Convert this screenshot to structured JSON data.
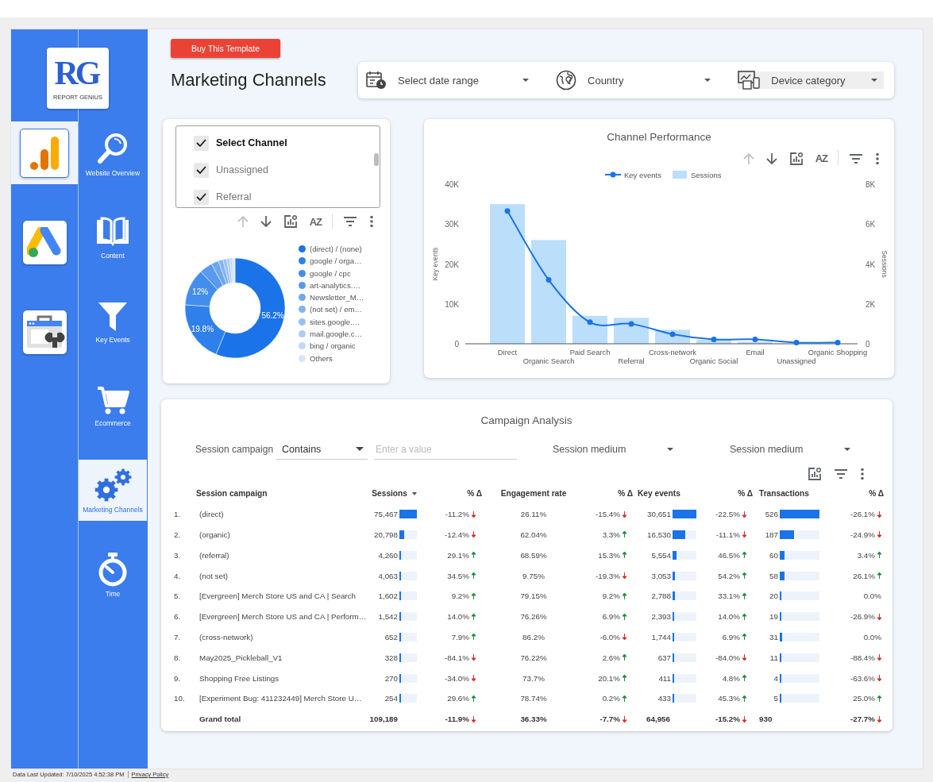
{
  "sidebar": {
    "logo": {
      "mark": "RG",
      "name": "REPORT GENIUS"
    },
    "apps": [
      {
        "kind": "analytics",
        "selected": true
      },
      {
        "kind": "ads",
        "selected": false
      },
      {
        "kind": "search-console",
        "selected": false
      }
    ],
    "nav": [
      {
        "kind": "search",
        "label": "Website Overview",
        "selected": false
      },
      {
        "kind": "book",
        "label": "Content",
        "selected": false
      },
      {
        "kind": "funnel",
        "label": "Key Events",
        "selected": false
      },
      {
        "kind": "cart",
        "label": "Ecommerce",
        "selected": false
      },
      {
        "kind": "gears",
        "label": "Marketing Channels",
        "selected": true
      },
      {
        "kind": "stopwatch",
        "label": "Time",
        "selected": false
      }
    ]
  },
  "header": {
    "button": "Buy This Template",
    "title": "Marketing Channels"
  },
  "filters": [
    {
      "kind": "date",
      "label": "Select date range",
      "highlighted": false
    },
    {
      "kind": "country",
      "label": "Country",
      "highlighted": false
    },
    {
      "kind": "device",
      "label": "Device category",
      "highlighted": true
    }
  ],
  "channel_card": {
    "checklist": [
      {
        "kind": "header",
        "label": "Select Channel",
        "checked": true
      },
      {
        "kind": "option",
        "label": "Unassigned",
        "checked": true
      },
      {
        "kind": "option",
        "label": "Referral",
        "checked": true
      }
    ],
    "toolbar": [
      {
        "kind": "up",
        "disabled": true
      },
      {
        "kind": "down",
        "disabled": false
      },
      {
        "kind": "chart-settings",
        "disabled": false
      },
      {
        "kind": "sort",
        "text": "AZ",
        "disabled": false
      },
      {
        "kind": "filter",
        "disabled": false
      },
      {
        "kind": "more",
        "disabled": false
      }
    ],
    "chart_data": {
      "type": "donut",
      "categories": [
        "(direct) / (none)",
        "google / orga…",
        "google / cpc",
        "art-analytics.…",
        "Newsletter_M…",
        "(not set) / em…",
        "sites.google.…",
        "mail.google.c…",
        "bing / organic",
        "Others"
      ],
      "values": [
        56.2,
        19.8,
        12,
        4.2,
        2.4,
        1.5,
        1.2,
        1.0,
        0.9,
        0.8
      ],
      "value_labels": [
        "56.2%",
        "19.8%",
        "12%",
        null,
        null,
        null,
        null,
        null,
        null,
        null
      ]
    }
  },
  "performance": {
    "toolbar": [
      {
        "kind": "up",
        "disabled": true
      },
      {
        "kind": "down",
        "disabled": false
      },
      {
        "kind": "chart-settings",
        "disabled": false
      },
      {
        "kind": "sort",
        "text": "AZ",
        "disabled": false
      },
      {
        "kind": "filter",
        "disabled": false
      },
      {
        "kind": "more",
        "disabled": false
      }
    ],
    "chart_data": {
      "type": "bar",
      "title": "Channel Performance",
      "ylabel": "Key events",
      "y2label": "Sessions",
      "legend": "top",
      "categories": [
        "Direct",
        "Organic Search",
        "Paid Search",
        "Referral",
        "Cross-network",
        "Organic Social",
        "Email",
        "Unassigned",
        "Organic Shopping"
      ],
      "series": [
        {
          "name": "Key events",
          "type": "line",
          "axis": "y",
          "marker": "circle",
          "color": "#1a73e8",
          "values": [
            33300,
            16000,
            5400,
            5000,
            2400,
            1100,
            1100,
            300,
            300
          ]
        },
        {
          "name": "Sessions",
          "type": "bar",
          "axis": "y2",
          "color": "#bbdefb",
          "values": [
            7000,
            5200,
            1400,
            1300,
            700,
            200,
            100,
            null,
            null
          ]
        }
      ],
      "ylim": [
        0,
        40000
      ],
      "y2lim": [
        0,
        8000
      ],
      "yticks": [
        {
          "value": 0,
          "label": "0"
        },
        {
          "value": 10000,
          "label": "10K"
        },
        {
          "value": 20000,
          "label": "20K"
        },
        {
          "value": 30000,
          "label": "30K"
        },
        {
          "value": 40000,
          "label": "40K"
        }
      ],
      "y2ticks": [
        {
          "value": 0,
          "label": "0"
        },
        {
          "value": 2000,
          "label": "2K"
        },
        {
          "value": 4000,
          "label": "4K"
        },
        {
          "value": 6000,
          "label": "6K"
        },
        {
          "value": 8000,
          "label": "8K"
        }
      ]
    }
  },
  "campaign": {
    "title": "Campaign Analysis",
    "filter": {
      "label": "Session campaign",
      "operator": "Contains",
      "placeholder": "Enter a value",
      "dropdowns": [
        "Session medium",
        "Session medium"
      ]
    },
    "toolbar": [
      {
        "kind": "chart-settings",
        "disabled": false
      },
      {
        "kind": "filter",
        "disabled": false
      },
      {
        "kind": "more",
        "disabled": false
      }
    ],
    "columns": [
      {
        "label": "Session campaign",
        "sorted": false
      },
      {
        "label": "Sessions",
        "sorted": true
      },
      {
        "label": "% Δ",
        "sorted": false
      },
      {
        "label": "Engagement rate",
        "sorted": false
      },
      {
        "label": "% Δ",
        "sorted": false
      },
      {
        "label": "Key events",
        "sorted": false
      },
      {
        "label": "% Δ",
        "sorted": false
      },
      {
        "label": "Transactions",
        "sorted": false
      },
      {
        "label": "% Δ",
        "sorted": false
      }
    ],
    "rows": [
      {
        "kind": "data",
        "rank": "1.",
        "cells": [
          {
            "kind": "name",
            "text": "(direct)"
          },
          {
            "kind": "bar",
            "text": "75,467",
            "level": 1
          },
          {
            "kind": "down",
            "text": "-11.2%"
          },
          {
            "kind": "plain",
            "text": "26.11%"
          },
          {
            "kind": "down",
            "text": "-15.4%"
          },
          {
            "kind": "bar",
            "text": "30,651",
            "level": 1
          },
          {
            "kind": "down",
            "text": "-22.5%"
          },
          {
            "kind": "bar",
            "text": "526",
            "level": 1
          },
          {
            "kind": "down",
            "text": "-26.1%"
          }
        ]
      },
      {
        "kind": "data",
        "rank": "2.",
        "cells": [
          {
            "kind": "name",
            "text": "(organic)"
          },
          {
            "kind": "bar",
            "text": "20,798",
            "level": 0.276
          },
          {
            "kind": "down",
            "text": "-12.4%"
          },
          {
            "kind": "plain",
            "text": "62.04%"
          },
          {
            "kind": "up",
            "text": "3.3%"
          },
          {
            "kind": "bar",
            "text": "16,530",
            "level": 0.539
          },
          {
            "kind": "down",
            "text": "-11.1%"
          },
          {
            "kind": "bar",
            "text": "187",
            "level": 0.356
          },
          {
            "kind": "down",
            "text": "-24.9%"
          }
        ]
      },
      {
        "kind": "data",
        "rank": "3.",
        "cells": [
          {
            "kind": "name",
            "text": "(referral)"
          },
          {
            "kind": "bar",
            "text": "4,260",
            "level": 0.056
          },
          {
            "kind": "up",
            "text": "29.1%"
          },
          {
            "kind": "plain",
            "text": "68.59%"
          },
          {
            "kind": "up",
            "text": "15.3%"
          },
          {
            "kind": "bar",
            "text": "5,554",
            "level": 0.181
          },
          {
            "kind": "up",
            "text": "46.5%"
          },
          {
            "kind": "bar",
            "text": "60",
            "level": 0.114
          },
          {
            "kind": "up",
            "text": "3.4%"
          }
        ]
      },
      {
        "kind": "data",
        "rank": "4.",
        "cells": [
          {
            "kind": "name",
            "text": "(not set)"
          },
          {
            "kind": "bar",
            "text": "4,063",
            "level": 0.054
          },
          {
            "kind": "up",
            "text": "34.5%"
          },
          {
            "kind": "plain",
            "text": "9.75%"
          },
          {
            "kind": "down",
            "text": "-19.3%"
          },
          {
            "kind": "bar",
            "text": "3,053",
            "level": 0.1
          },
          {
            "kind": "up",
            "text": "54.2%"
          },
          {
            "kind": "bar",
            "text": "58",
            "level": 0.11
          },
          {
            "kind": "up",
            "text": "26.1%"
          }
        ]
      },
      {
        "kind": "data",
        "rank": "5.",
        "cells": [
          {
            "kind": "name",
            "text": "[Evergreen] Merch Store US and CA | Search"
          },
          {
            "kind": "bar",
            "text": "1,602",
            "level": 0.021
          },
          {
            "kind": "up",
            "text": "9.2%"
          },
          {
            "kind": "plain",
            "text": "79.15%"
          },
          {
            "kind": "up",
            "text": "9.2%"
          },
          {
            "kind": "bar",
            "text": "2,788",
            "level": 0.091
          },
          {
            "kind": "up",
            "text": "33.1%"
          },
          {
            "kind": "bar",
            "text": "20",
            "level": 0.038
          },
          {
            "kind": "flat",
            "text": "0.0%"
          }
        ]
      },
      {
        "kind": "data",
        "rank": "6.",
        "cells": [
          {
            "kind": "name",
            "text": "[Evergreen] Merch Store US and CA | Perform…"
          },
          {
            "kind": "bar",
            "text": "1,542",
            "level": 0.02
          },
          {
            "kind": "up",
            "text": "14.0%"
          },
          {
            "kind": "plain",
            "text": "76.26%"
          },
          {
            "kind": "up",
            "text": "6.9%"
          },
          {
            "kind": "bar",
            "text": "2,393",
            "level": 0.078
          },
          {
            "kind": "up",
            "text": "14.0%"
          },
          {
            "kind": "bar",
            "text": "19",
            "level": 0.036
          },
          {
            "kind": "down",
            "text": "-26.9%"
          }
        ]
      },
      {
        "kind": "data",
        "rank": "7.",
        "cells": [
          {
            "kind": "name",
            "text": "(cross-network)"
          },
          {
            "kind": "bar",
            "text": "652",
            "level": 0.009
          },
          {
            "kind": "up",
            "text": "7.9%"
          },
          {
            "kind": "plain",
            "text": "86.2%"
          },
          {
            "kind": "down",
            "text": "-6.0%"
          },
          {
            "kind": "bar",
            "text": "1,744",
            "level": 0.057
          },
          {
            "kind": "up",
            "text": "6.9%"
          },
          {
            "kind": "bar",
            "text": "31",
            "level": 0.059
          },
          {
            "kind": "flat",
            "text": "0.0%"
          }
        ]
      },
      {
        "kind": "data",
        "rank": "8.",
        "cells": [
          {
            "kind": "name",
            "text": "May2025_Pickleball_V1"
          },
          {
            "kind": "bar",
            "text": "328",
            "level": 0.004
          },
          {
            "kind": "down",
            "text": "-84.1%"
          },
          {
            "kind": "plain",
            "text": "76.22%"
          },
          {
            "kind": "up",
            "text": "2.6%"
          },
          {
            "kind": "bar",
            "text": "637",
            "level": 0.021
          },
          {
            "kind": "down",
            "text": "-84.0%"
          },
          {
            "kind": "bar",
            "text": "11",
            "level": 0.021
          },
          {
            "kind": "down",
            "text": "-88.4%"
          }
        ]
      },
      {
        "kind": "data",
        "rank": "9.",
        "cells": [
          {
            "kind": "name",
            "text": "Shopping Free Listings"
          },
          {
            "kind": "bar",
            "text": "270",
            "level": 0.004
          },
          {
            "kind": "down",
            "text": "-34.0%"
          },
          {
            "kind": "plain",
            "text": "73.7%"
          },
          {
            "kind": "up",
            "text": "20.1%"
          },
          {
            "kind": "bar",
            "text": "411",
            "level": 0.013
          },
          {
            "kind": "up",
            "text": "4.8%"
          },
          {
            "kind": "bar",
            "text": "4",
            "level": 0.008
          },
          {
            "kind": "down",
            "text": "-63.6%"
          }
        ]
      },
      {
        "kind": "data",
        "rank": "10.",
        "cells": [
          {
            "kind": "name",
            "text": "[Experiment Bug: 411232449] Merch Store U…"
          },
          {
            "kind": "bar",
            "text": "254",
            "level": 0.003
          },
          {
            "kind": "up",
            "text": "29.6%"
          },
          {
            "kind": "plain",
            "text": "78.74%"
          },
          {
            "kind": "up",
            "text": "0.2%"
          },
          {
            "kind": "bar",
            "text": "433",
            "level": 0.014
          },
          {
            "kind": "up",
            "text": "45.3%"
          },
          {
            "kind": "bar",
            "text": "5",
            "level": 0.01
          },
          {
            "kind": "up",
            "text": "25.0%"
          }
        ]
      },
      {
        "kind": "total",
        "cells": [
          {
            "kind": "name",
            "text": "Grand total"
          },
          {
            "kind": "plain",
            "text": "109,189"
          },
          {
            "kind": "down",
            "text": "-11.9%"
          },
          {
            "kind": "plain",
            "text": "36.33%"
          },
          {
            "kind": "down",
            "text": "-7.7%"
          },
          {
            "kind": "plain",
            "text": "64,956"
          },
          {
            "kind": "down",
            "text": "-15.2%"
          },
          {
            "kind": "plain",
            "text": "930"
          },
          {
            "kind": "down",
            "text": "-27.7%"
          }
        ]
      }
    ]
  },
  "footer": {
    "updated": "Data Last Updated: 7/10/2025 4:52:38 PM",
    "link": "Privacy Policy"
  }
}
